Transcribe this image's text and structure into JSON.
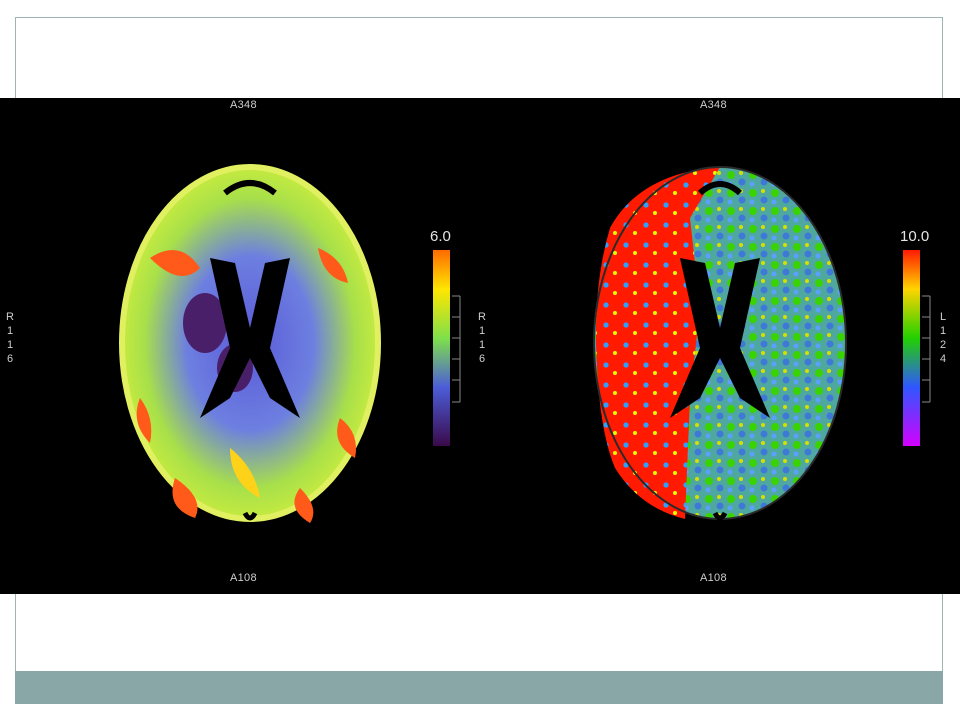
{
  "slide": {
    "frame_color": "#9fb3b3",
    "footer_color": "#89a7a7"
  },
  "left_map": {
    "anterior_label": "A348",
    "posterior_label": "A108",
    "side_label_chars": [
      "R",
      "1",
      "1",
      "6"
    ],
    "mid_label_chars": [
      "R",
      "1",
      "1",
      "6"
    ],
    "scale_max": "6.0",
    "colormap": "purple-blue-green-yellow-red"
  },
  "right_map": {
    "anterior_label": "A348",
    "posterior_label": "A108",
    "side_label_chars": [
      "L",
      "1",
      "2",
      "4"
    ],
    "scale_max": "10.0",
    "colormap": "magenta-blue-green-yellow-red"
  }
}
